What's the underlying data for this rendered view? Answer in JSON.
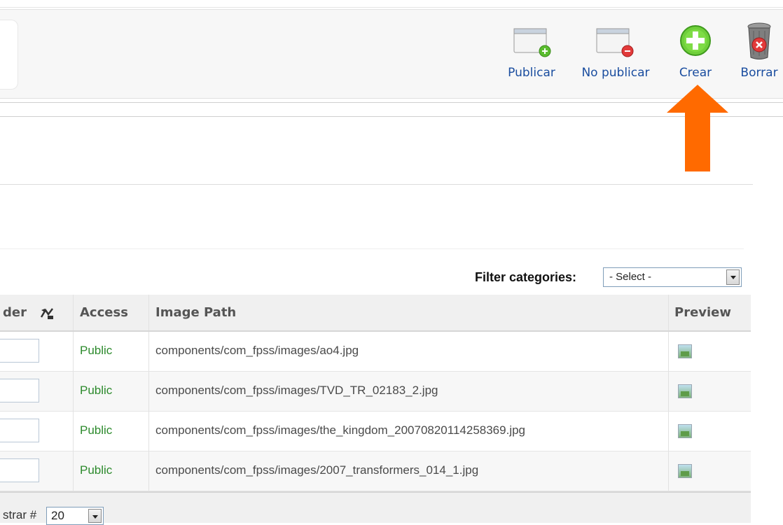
{
  "toolbar": {
    "buttons": [
      {
        "label": "Publicar",
        "icon": "publish-icon"
      },
      {
        "label": "No publicar",
        "icon": "unpublish-icon"
      },
      {
        "label": "Crear",
        "icon": "new-icon"
      },
      {
        "label": "Borrar",
        "icon": "trash-icon"
      }
    ]
  },
  "annotation": {
    "arrow_color": "#ff6a00"
  },
  "filter": {
    "label": "Filter categories:",
    "selected": "- Select -"
  },
  "table": {
    "headers": {
      "order": "der",
      "access": "Access",
      "image_path": "Image Path",
      "preview": "Preview"
    },
    "rows": [
      {
        "access": "Public",
        "path": "components/com_fpss/images/ao4.jpg"
      },
      {
        "access": "Public",
        "path": "components/com_fpss/images/TVD_TR_02183_2.jpg"
      },
      {
        "access": "Public",
        "path": "components/com_fpss/images/the_kingdom_20070820114258369.jpg"
      },
      {
        "access": "Public",
        "path": "components/com_fpss/images/2007_transformers_014_1.jpg"
      }
    ]
  },
  "footer": {
    "display_label": "strar #",
    "limit": "20"
  },
  "colors": {
    "link": "#1a4d9f",
    "access_public": "#2c8a2c",
    "arrow": "#ff6a00"
  }
}
